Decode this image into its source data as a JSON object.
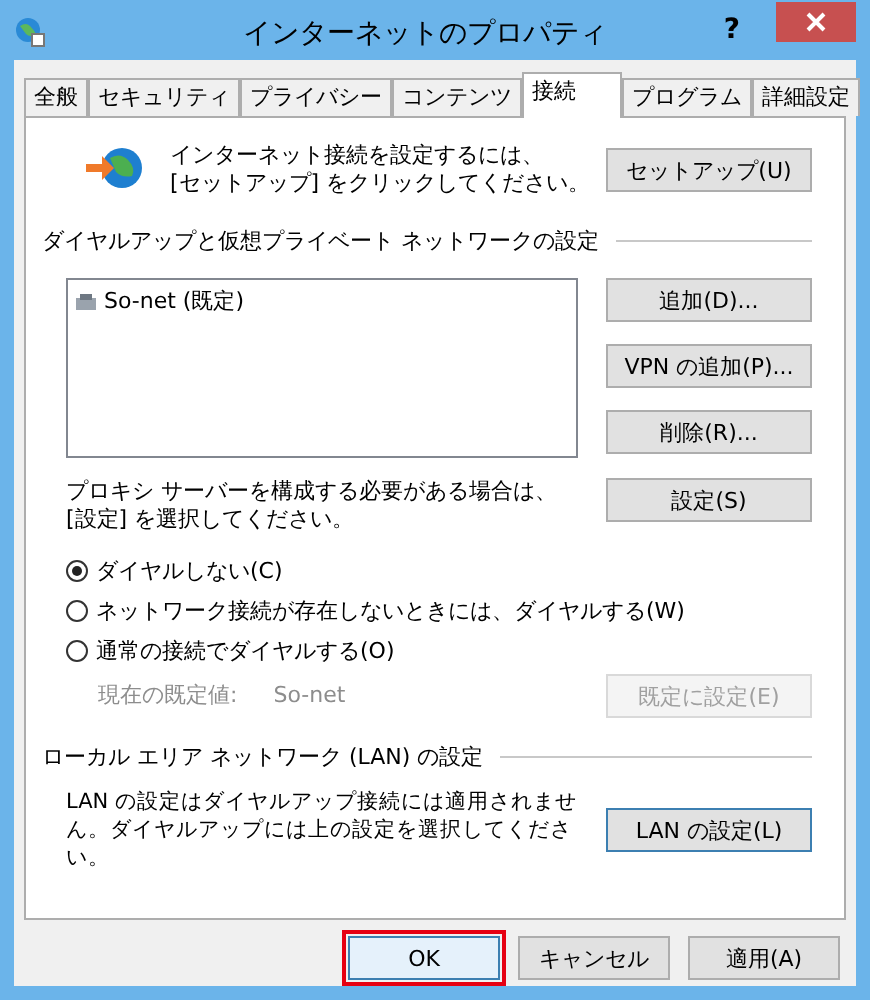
{
  "window": {
    "title": "インターネットのプロパティ",
    "help": "?"
  },
  "tabs": [
    {
      "label": "全般",
      "selected": false
    },
    {
      "label": "セキュリティ",
      "selected": false
    },
    {
      "label": "プライバシー",
      "selected": false
    },
    {
      "label": "コンテンツ",
      "selected": false
    },
    {
      "label": "接続",
      "selected": true
    },
    {
      "label": "プログラム",
      "selected": false
    },
    {
      "label": "詳細設定",
      "selected": false
    }
  ],
  "setup": {
    "text": "インターネット接続を設定するには、\n[セットアップ] をクリックしてください。",
    "button": "セットアップ(U)"
  },
  "dialup": {
    "heading": "ダイヤルアップと仮想プライベート ネットワークの設定",
    "connections": [
      {
        "name": "So-net (既定)",
        "selected": false
      }
    ],
    "buttons": [
      {
        "label": "追加(D)...",
        "disabled": false
      },
      {
        "label": "VPN の追加(P)...",
        "disabled": false
      },
      {
        "label": "削除(R)...",
        "disabled": false
      }
    ],
    "proxy_text": "プロキシ サーバーを構成する必要がある場合は、\n[設定] を選択してください。",
    "proxy_button": {
      "label": "設定(S)",
      "disabled": false
    },
    "options": [
      {
        "label": "ダイヤルしない(C)",
        "selected": true
      },
      {
        "label": "ネットワーク接続が存在しないときには、ダイヤルする(W)",
        "selected": false
      },
      {
        "label": "通常の接続でダイヤルする(O)",
        "selected": false
      }
    ],
    "current_label": "現在の既定値:",
    "current_value": "So-net",
    "current_disabled": true,
    "default_button": {
      "label": "既定に設定(E)",
      "disabled": true
    }
  },
  "lan": {
    "heading": "ローカル エリア ネットワーク (LAN) の設定",
    "text": "LAN の設定はダイヤルアップ接続には適用されません。ダイヤルアップには上の設定を選択してください。",
    "button": "LAN の設定(L)"
  },
  "buttons": [
    {
      "label": "OK",
      "default": true,
      "highlighted": true
    },
    {
      "label": "キャンセル",
      "default": false,
      "highlighted": false
    },
    {
      "label": "適用(A)",
      "default": false,
      "highlighted": false
    }
  ]
}
